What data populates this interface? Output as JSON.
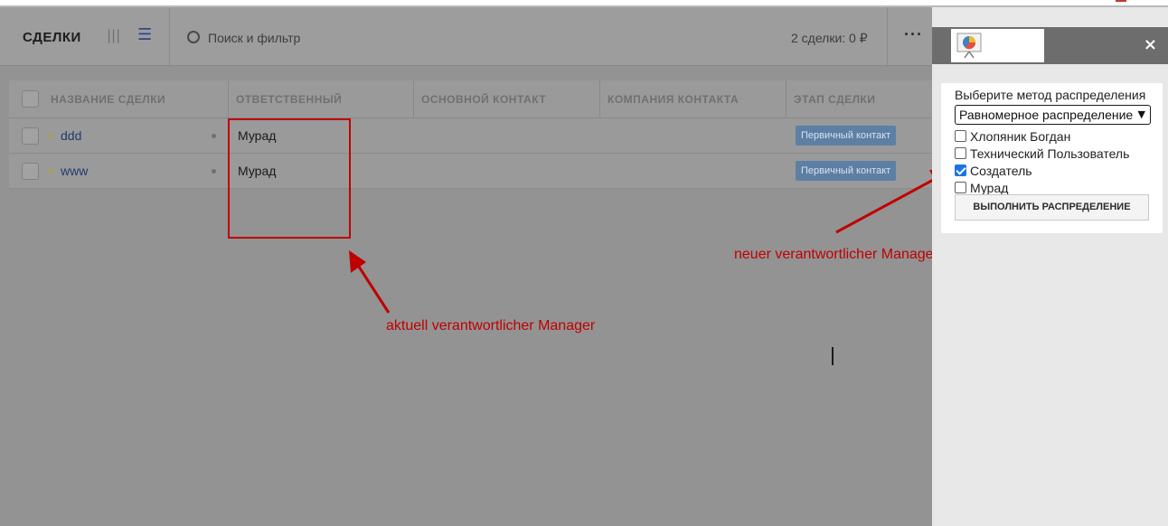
{
  "app": {
    "title": "СДЕЛКИ",
    "search_placeholder": "Поиск и фильтр",
    "summary": "2 сделки: 0 ₽",
    "more": "···"
  },
  "table": {
    "columns": [
      "НАЗВАНИЕ СДЕЛКИ",
      "ОТВЕТСТВЕННЫЙ",
      "ОСНОВНОЙ КОНТАКТ",
      "КОМПАНИЯ КОНТАКТА",
      "ЭТАП СДЕЛКИ"
    ],
    "rows": [
      {
        "name": "ddd",
        "responsible": "Мурад",
        "stage": "Первичный контакт"
      },
      {
        "name": "www",
        "responsible": "Мурад",
        "stage": "Первичный контакт"
      }
    ]
  },
  "panel": {
    "close": "×",
    "method_label": "Выберите метод распределения",
    "method_value": "Равномерное распределение",
    "users": [
      {
        "label": "Хлопяник Богдан",
        "checked": false
      },
      {
        "label": "Технический Пользователь",
        "checked": false
      },
      {
        "label": "Создатель",
        "checked": true
      },
      {
        "label": "Мурад",
        "checked": false
      }
    ],
    "run_button": "ВЫПОЛНИТЬ РАСПРЕДЕЛЕНИЕ"
  },
  "annotations": {
    "current": "aktuell verantwortlicher Manager",
    "new": "neuer verantwortlicher Manager"
  },
  "colors": {
    "annotation": "#c00000",
    "stage_badge": "#5d7fa4",
    "checkbox_checked": "#1a73e8"
  }
}
